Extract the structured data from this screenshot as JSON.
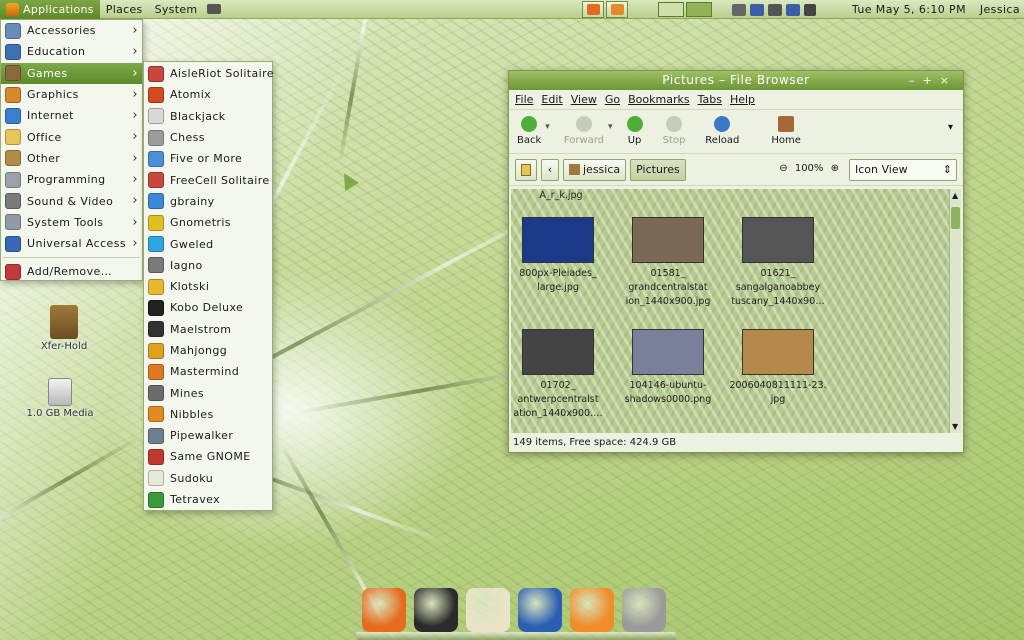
{
  "top_panel": {
    "menus": [
      "Applications",
      "Places",
      "System"
    ],
    "clock": "Tue May  5,  6:10 PM",
    "user": "Jessica"
  },
  "app_menu": {
    "items": [
      {
        "label": "Accessories",
        "icon": "accessories-icon",
        "color": "#6a8bb8",
        "submenu": true
      },
      {
        "label": "Education",
        "icon": "education-icon",
        "color": "#3f6fb5",
        "submenu": true
      },
      {
        "label": "Games",
        "icon": "games-icon",
        "color": "#8a6a3c",
        "submenu": true,
        "selected": true
      },
      {
        "label": "Graphics",
        "icon": "graphics-icon",
        "color": "#d9862f",
        "submenu": true
      },
      {
        "label": "Internet",
        "icon": "internet-icon",
        "color": "#3a7ecf",
        "submenu": true
      },
      {
        "label": "Office",
        "icon": "office-icon",
        "color": "#e6c65a",
        "submenu": true
      },
      {
        "label": "Other",
        "icon": "other-icon",
        "color": "#b48a4a",
        "submenu": true
      },
      {
        "label": "Programming",
        "icon": "programming-icon",
        "color": "#9aa1a8",
        "submenu": true
      },
      {
        "label": "Sound & Video",
        "icon": "sound-video-icon",
        "color": "#7a7a7a",
        "submenu": true
      },
      {
        "label": "System Tools",
        "icon": "system-tools-icon",
        "color": "#8f9aa6",
        "submenu": true
      },
      {
        "label": "Universal Access",
        "icon": "universal-access-icon",
        "color": "#3768b8",
        "submenu": true
      }
    ],
    "extra": {
      "label": "Add/Remove…",
      "icon": "add-remove-icon",
      "color": "#c23b3b"
    }
  },
  "games_menu": {
    "items": [
      {
        "label": "AisleRiot Solitaire",
        "color": "#c8463c"
      },
      {
        "label": "Atomix",
        "color": "#d24a1e"
      },
      {
        "label": "Blackjack",
        "color": "#d9d9d9"
      },
      {
        "label": "Chess",
        "color": "#9c9c9c"
      },
      {
        "label": "Five or More",
        "color": "#4a8fd9"
      },
      {
        "label": "FreeCell Solitaire",
        "color": "#c8463c"
      },
      {
        "label": "gbrainy",
        "color": "#3b88d6"
      },
      {
        "label": "Gnometris",
        "color": "#e0c020"
      },
      {
        "label": "Gweled",
        "color": "#2fa7e0"
      },
      {
        "label": "Iagno",
        "color": "#7a7a7a"
      },
      {
        "label": "Klotski",
        "color": "#e8b930"
      },
      {
        "label": "Kobo Deluxe",
        "color": "#222222"
      },
      {
        "label": "Maelstrom",
        "color": "#333333"
      },
      {
        "label": "Mahjongg",
        "color": "#e0a020"
      },
      {
        "label": "Mastermind",
        "color": "#e07a20"
      },
      {
        "label": "Mines",
        "color": "#6c6c6c"
      },
      {
        "label": "Nibbles",
        "color": "#e08a20"
      },
      {
        "label": "Pipewalker",
        "color": "#6f7f8f"
      },
      {
        "label": "Same GNOME",
        "color": "#c0392b"
      },
      {
        "label": "Sudoku",
        "color": "#e8e8d8"
      },
      {
        "label": "Tetravex",
        "color": "#3a9a3a"
      }
    ]
  },
  "desktop_icons": [
    {
      "label": "Xfer-Hold",
      "icon": "folder-icon"
    },
    {
      "label": "1.0 GB Media",
      "icon": "drive-icon"
    }
  ],
  "file_browser": {
    "title": "Pictures – File Browser",
    "menus": [
      "File",
      "Edit",
      "View",
      "Go",
      "Bookmarks",
      "Tabs",
      "Help"
    ],
    "toolbar": {
      "back": "Back",
      "forward": "Forward",
      "up": "Up",
      "stop": "Stop",
      "reload": "Reload",
      "home": "Home"
    },
    "path": [
      "jessica",
      "Pictures"
    ],
    "zoom": "100%",
    "view_mode": "Icon View",
    "partial_label": "A_r_k.jpg",
    "files": [
      {
        "lines": [
          "800px-Pleiades_",
          "large.jpg"
        ],
        "thumb": "#1d3a8a"
      },
      {
        "lines": [
          "01581_",
          "grandcentralstat",
          "ion_1440x900.jpg"
        ],
        "thumb": "#7a6a55"
      },
      {
        "lines": [
          "01621_",
          "sangalganoabbey",
          "tuscany_1440x90…"
        ],
        "thumb": "#555555"
      },
      {
        "lines": [
          "01702_",
          "antwerpcentralst",
          "ation_1440x900.…"
        ],
        "thumb": "#444444"
      },
      {
        "lines": [
          "104146-ubuntu-",
          "shadows0000.png"
        ],
        "thumb": "#7a809a"
      },
      {
        "lines": [
          "2006040811111-23.",
          "jpg"
        ],
        "thumb": "#b5894a"
      }
    ],
    "status": "149 items, Free space: 424.9 GB"
  },
  "dock": [
    {
      "name": "firefox",
      "color": "#e66a1f"
    },
    {
      "name": "terminal",
      "color": "#2b2b2b"
    },
    {
      "name": "text-editor",
      "color": "#e9e3c8"
    },
    {
      "name": "thunderbird",
      "color": "#2c5fb3"
    },
    {
      "name": "pidgin-bird",
      "color": "#f08c2a"
    },
    {
      "name": "file-cabinet",
      "color": "#9a9a9a"
    }
  ]
}
